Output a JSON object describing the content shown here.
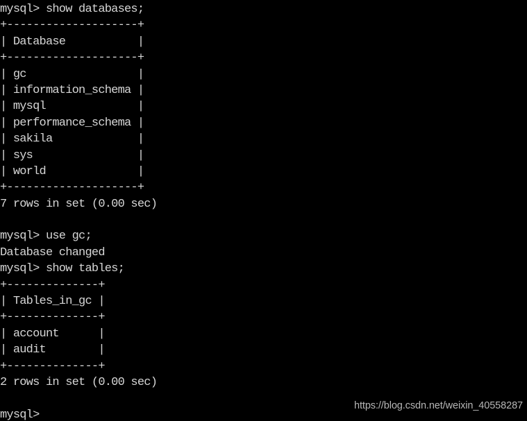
{
  "terminal": {
    "prompt": "mysql> ",
    "background_color": "#000000",
    "text_color": "#d6d6d6",
    "lines": [
      "mysql> show databases;",
      "+--------------------+",
      "| Database           |",
      "+--------------------+",
      "| gc                 |",
      "| information_schema |",
      "| mysql              |",
      "| performance_schema |",
      "| sakila             |",
      "| sys                |",
      "| world              |",
      "+--------------------+",
      "7 rows in set (0.00 sec)",
      "",
      "mysql> use gc;",
      "Database changed",
      "mysql> show tables;",
      "+--------------+",
      "| Tables_in_gc |",
      "+--------------+",
      "| account      |",
      "| audit        |",
      "+--------------+",
      "2 rows in set (0.00 sec)",
      "",
      "mysql> "
    ],
    "commands": [
      "show databases;",
      "use gc;",
      "show tables;"
    ],
    "results": {
      "databases": {
        "header": "Database",
        "rows": [
          "gc",
          "information_schema",
          "mysql",
          "performance_schema",
          "sakila",
          "sys",
          "world"
        ],
        "status": "7 rows in set (0.00 sec)"
      },
      "use_database": {
        "database": "gc",
        "status": "Database changed"
      },
      "tables": {
        "header": "Tables_in_gc",
        "rows": [
          "account",
          "audit"
        ],
        "status": "2 rows in set (0.00 sec)"
      }
    }
  },
  "watermark": {
    "text": "https://blog.csdn.net/weixin_40558287",
    "color": "#c6c6c6"
  }
}
